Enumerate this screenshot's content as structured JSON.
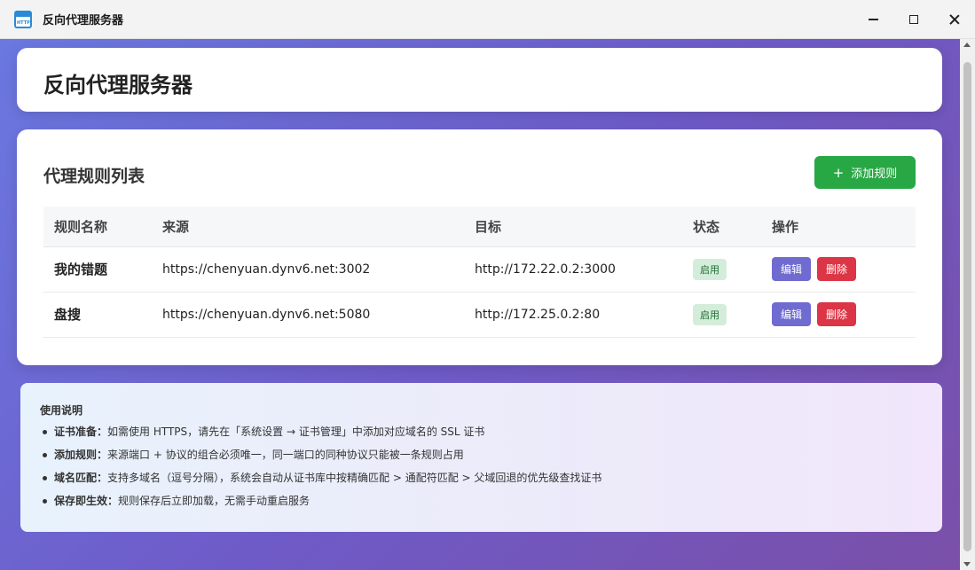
{
  "window": {
    "icon_text": "HTTP",
    "title": "反向代理服务器"
  },
  "header": {
    "title": "反向代理服务器"
  },
  "rules_section": {
    "title": "代理规则列表",
    "add_button_icon": "+",
    "add_button_label": "添加规则",
    "columns": [
      "规则名称",
      "来源",
      "目标",
      "状态",
      "操作"
    ],
    "rows": [
      {
        "name": "我的错题",
        "source": "https://chenyuan.dynv6.net:3002",
        "target": "http://172.22.0.2:3000",
        "status": "启用",
        "edit_label": "编辑",
        "delete_label": "删除"
      },
      {
        "name": "盘搜",
        "source": "https://chenyuan.dynv6.net:5080",
        "target": "http://172.25.0.2:80",
        "status": "启用",
        "edit_label": "编辑",
        "delete_label": "删除"
      }
    ]
  },
  "instructions": {
    "title": "使用说明",
    "items": [
      {
        "label": "证书准备：",
        "text": "如需使用 HTTPS，请先在「系统设置 → 证书管理」中添加对应域名的 SSL 证书"
      },
      {
        "label": "添加规则：",
        "text": "来源端口 + 协议的组合必须唯一，同一端口的同种协议只能被一条规则占用"
      },
      {
        "label": "域名匹配：",
        "text": "支持多域名（逗号分隔），系统会自动从证书库中按精确匹配 > 通配符匹配 > 父域回退的优先级查找证书"
      },
      {
        "label": "保存即生效：",
        "text": "规则保存后立即加载，无需手动重启服务"
      }
    ]
  },
  "colors": {
    "accent_green": "#28a745",
    "edit_purple": "#6f6bd0",
    "delete_red": "#dc3545",
    "status_bg": "#d4edda"
  }
}
